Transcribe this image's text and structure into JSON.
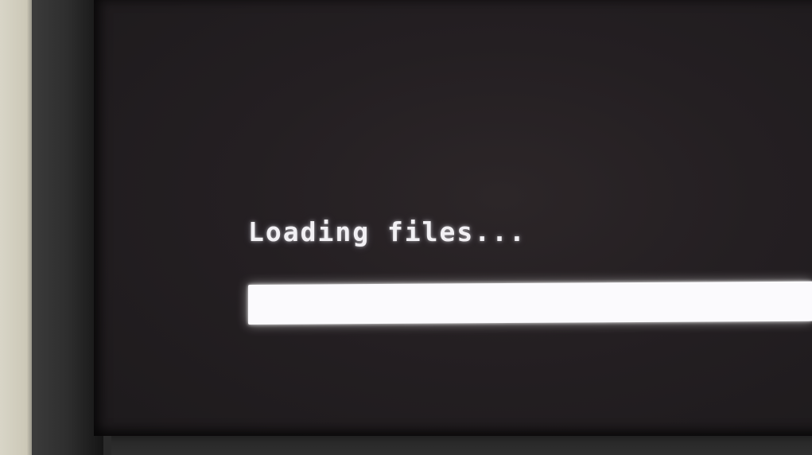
{
  "boot_screen": {
    "status_text": "Loading files...",
    "progress_fraction": 1.0
  },
  "colors": {
    "screen_background": "#241f22",
    "text": "#f2f0f4",
    "progress_fill": "#fbfafd"
  }
}
